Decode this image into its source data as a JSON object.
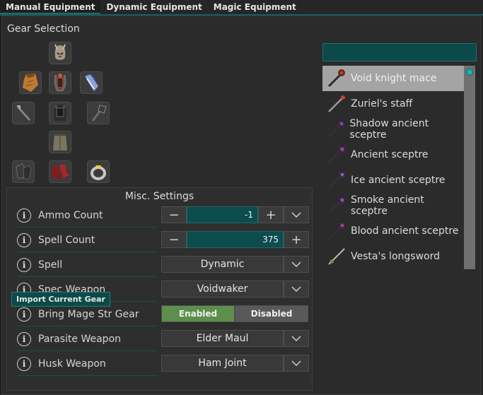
{
  "tabs": [
    {
      "label": "Manual Equipment"
    },
    {
      "label": "Dynamic Equipment"
    },
    {
      "label": "Magic Equipment"
    }
  ],
  "gear": {
    "title": "Gear Selection",
    "slots": [
      {
        "name": "head",
        "icon": "void-mage-helm-icon"
      },
      {
        "name": "cape",
        "icon": "cape-icon"
      },
      {
        "name": "neck",
        "icon": "amulet-icon"
      },
      {
        "name": "ammo",
        "icon": "rune-pouch-icon"
      },
      {
        "name": "weapon",
        "icon": "staff-icon"
      },
      {
        "name": "body",
        "icon": "void-top-icon"
      },
      {
        "name": "shield",
        "icon": "mace-icon"
      },
      {
        "name": "legs",
        "icon": "void-robe-icon"
      },
      {
        "name": "hands",
        "icon": "gloves-icon"
      },
      {
        "name": "feet",
        "icon": "boots-icon"
      },
      {
        "name": "ring",
        "icon": "ring-icon"
      }
    ]
  },
  "search": {
    "value": ""
  },
  "items": [
    {
      "label": "Void knight mace",
      "selected": true,
      "icon": "mace-icon"
    },
    {
      "label": "Zuriel's staff",
      "selected": false,
      "icon": "staff-icon"
    },
    {
      "label": "Shadow ancient sceptre",
      "selected": false,
      "icon": "sceptre-icon"
    },
    {
      "label": "Ancient sceptre",
      "selected": false,
      "icon": "sceptre-icon"
    },
    {
      "label": "Ice ancient sceptre",
      "selected": false,
      "icon": "sceptre-icon"
    },
    {
      "label": "Smoke ancient sceptre",
      "selected": false,
      "icon": "sceptre-icon"
    },
    {
      "label": "Blood ancient sceptre",
      "selected": false,
      "icon": "sceptre-icon"
    },
    {
      "label": "Vesta's longsword",
      "selected": false,
      "icon": "longsword-icon"
    }
  ],
  "misc": {
    "title": "Misc. Settings",
    "ammo_count": {
      "label": "Ammo Count",
      "value": "-1"
    },
    "spell_count": {
      "label": "Spell Count",
      "value": "375"
    },
    "spell": {
      "label": "Spell",
      "value": "Dynamic"
    },
    "spec_weapon": {
      "label": "Spec Weapon",
      "value": "Voidwaker"
    },
    "mage_str": {
      "label": "Bring Mage Str Gear",
      "on_label": "Enabled",
      "off_label": "Disabled",
      "state": "Enabled"
    },
    "parasite": {
      "label": "Parasite Weapon",
      "value": "Elder Maul"
    },
    "husk": {
      "label": "Husk Weapon",
      "value": "Ham Joint"
    }
  },
  "tooltip": {
    "label": "Import Current Gear"
  },
  "colors": {
    "accent": "#0c4a4a",
    "enabled": "#5c8f4c",
    "disabled": "#595959"
  }
}
